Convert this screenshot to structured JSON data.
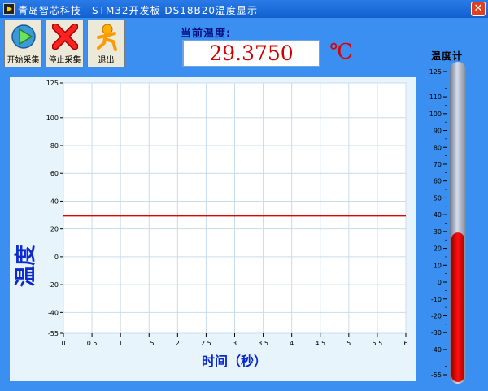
{
  "window": {
    "title": "青岛智芯科技—STM32开发板 DS18B20温度显示",
    "close_label": "✕"
  },
  "toolbar": {
    "start_label": "开始采集",
    "stop_label": "停止采集",
    "exit_label": "退出"
  },
  "current": {
    "label": "当前温度:",
    "value": "29.3750",
    "unit": "℃"
  },
  "thermometer": {
    "label": "温度计",
    "value": 29.375,
    "min": -55,
    "max": 125,
    "ticks": [
      125,
      110,
      100,
      90,
      80,
      70,
      60,
      50,
      40,
      30,
      20,
      10,
      0,
      -10,
      -20,
      -30,
      -40,
      -55
    ],
    "fill_color": "#ee0000"
  },
  "chart_data": {
    "type": "line",
    "ylabel": "温度",
    "xlabel": "时间（秒）",
    "ylim": [
      -55,
      125
    ],
    "xlim": [
      0,
      6
    ],
    "yticks": [
      125,
      100,
      80,
      60,
      40,
      20,
      0,
      -20,
      -40,
      -55
    ],
    "xticks": [
      "0",
      "0.5",
      "1",
      "1.5",
      "2",
      "2.5",
      "3",
      "3.5",
      "4",
      "4.5",
      "5",
      "5.5",
      "6"
    ],
    "series": [
      {
        "x": [
          0,
          6
        ],
        "y": [
          29.375,
          29.375
        ],
        "color": "#e00000"
      }
    ],
    "grid": true
  }
}
